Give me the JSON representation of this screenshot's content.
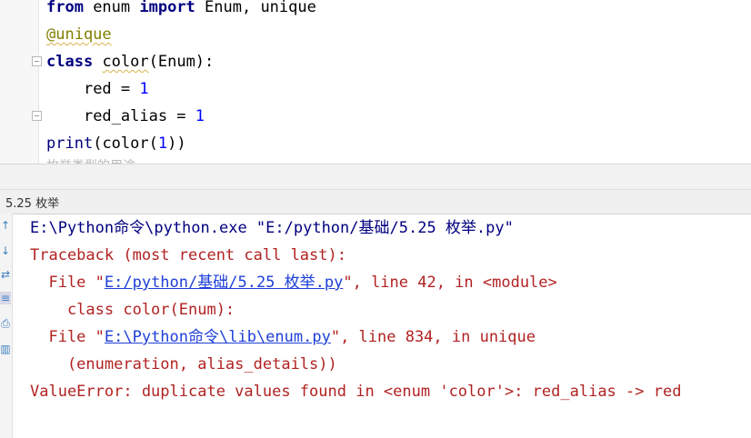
{
  "editor": {
    "line1": {
      "kw_from": "from",
      "module": " enum ",
      "kw_import": "import",
      "names": " Enum, unique"
    },
    "line2": {
      "decorator": "@unique"
    },
    "line3": {
      "kw_class": "class",
      "space": " ",
      "name": "color",
      "rest": "(Enum):"
    },
    "line4": {
      "indent": "    ",
      "name": "red = ",
      "value": "1"
    },
    "line5": {
      "indent": "    ",
      "name": "red_alias = ",
      "value": "1"
    },
    "line6": {
      "func": "print",
      "open": "(",
      "call": "color(",
      "arg": "1",
      "close": "))"
    },
    "cut_line": "枚举类型的用途"
  },
  "run_tab": {
    "label": "5.25 枚举"
  },
  "console": {
    "cmd": "E:\\Python命令\\python.exe \"E:/python/基础/5.25 枚举.py\"",
    "traceback": "Traceback (most recent call last):",
    "file1": {
      "prefix": "  File \"",
      "link": "E:/python/基础/5.25 枚举.py",
      "suffix": "\", line 42, in <module>"
    },
    "code1": "    class color(Enum):",
    "file2": {
      "prefix": "  File \"",
      "link": "E:\\Python命令\\lib\\enum.py",
      "suffix": "\", line 834, in unique"
    },
    "code2": "    (enumeration, alias_details))",
    "error": "ValueError: duplicate values found in <enum 'color'>: red_alias -> red"
  }
}
